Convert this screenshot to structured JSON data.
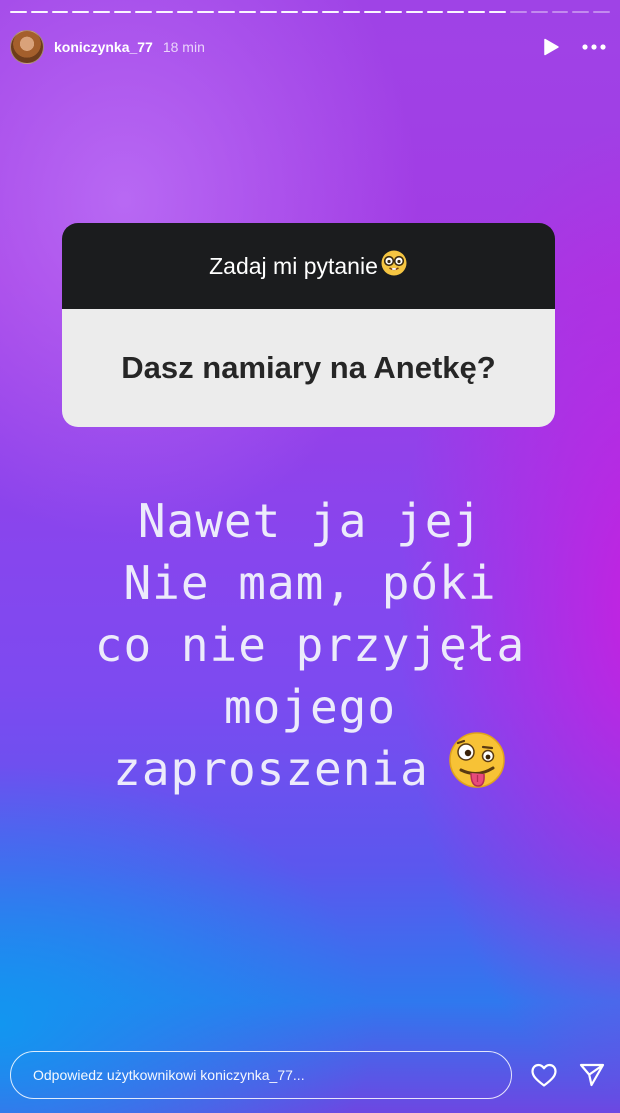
{
  "header": {
    "username": "koniczynka_77",
    "time": "18 min",
    "icons": {
      "play": "play-icon",
      "more": "more-icon"
    }
  },
  "progress": {
    "segments": 29,
    "completed": 24
  },
  "question_sticker": {
    "title": "Zadaj mi pytanie",
    "title_emoji": "nerd-face-emoji",
    "question": "Dasz namiary na Anetkę?"
  },
  "story_text": {
    "lines": [
      "Nawet ja jej",
      "Nie mam, póki",
      "co nie przyjęła",
      "mojego",
      "zaproszenia"
    ],
    "emoji": "zany-face-emoji"
  },
  "footer": {
    "reply_placeholder": "Odpowiedz użytkownikowi koniczynka_77...",
    "icons": {
      "like": "heart-icon",
      "share": "send-icon"
    }
  },
  "colors": {
    "card_header_bg": "#1b1c1e",
    "card_body_bg": "#ececec",
    "story_text": "#ecebfb"
  }
}
